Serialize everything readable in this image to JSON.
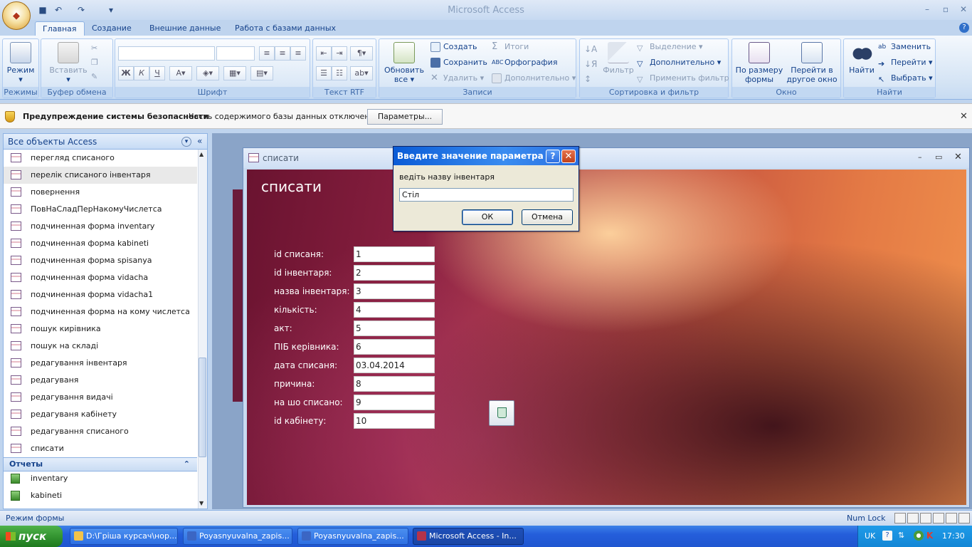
{
  "app": {
    "title": "Microsoft Access"
  },
  "quick_access": {
    "save": "save-icon",
    "undo": "undo-icon",
    "redo": "redo-icon"
  },
  "tabs": [
    {
      "label": "Главная",
      "active": true
    },
    {
      "label": "Создание"
    },
    {
      "label": "Внешние данные"
    },
    {
      "label": "Работа с базами данных"
    }
  ],
  "ribbon": {
    "views": {
      "mode": "Режим",
      "group": "Режимы"
    },
    "clipboard": {
      "paste": "Вставить",
      "group": "Буфер обмена"
    },
    "font": {
      "group": "Шрифт"
    },
    "rtf": {
      "group": "Текст RTF"
    },
    "records": {
      "refresh": "Обновить",
      "refresh2": "все",
      "create": "Создать",
      "save": "Сохранить",
      "delete": "Удалить",
      "totals": "Итоги",
      "spelling": "Орфография",
      "more": "Дополнительно",
      "group": "Записи"
    },
    "sort": {
      "filter": "Фильтр",
      "selection": "Выделение",
      "advanced": "Дополнительно",
      "toggle": "Применить фильтр",
      "group": "Сортировка и фильтр"
    },
    "window": {
      "fit1": "По размеру",
      "fit2": "формы",
      "switch1": "Перейти в",
      "switch2": "другое окно",
      "group": "Окно"
    },
    "find": {
      "find": "Найти",
      "replace": "Заменить",
      "goto": "Перейти",
      "select": "Выбрать",
      "group": "Найти"
    }
  },
  "security": {
    "title": "Предупреждение системы безопасности",
    "message": "Часть содержимого базы данных отключено",
    "button": "Параметры..."
  },
  "nav": {
    "header": "Все объекты Access",
    "forms": [
      "перегляд списаного",
      "перелік списаного інвентаря",
      "повернення",
      "ПовНаСладПерНакомуЧислетса",
      "подчиненная форма inventary",
      "подчиненная форма kabineti",
      "подчиненная форма spisanya",
      "подчиненная форма vidacha",
      "подчиненная форма vidacha1",
      "подчиненная форма на кому числетса",
      "пошук кирівника",
      "пошук на складі",
      "редагування інвентаря",
      "редагуваня",
      "редагування видачі",
      "редагуваня кабінету",
      "редагування списаного",
      "списати"
    ],
    "selected_index": 1,
    "reports_header": "Отчеты",
    "reports": [
      "inventary",
      "kabineti"
    ]
  },
  "form": {
    "window_title": "списати",
    "title": "списати",
    "fields": [
      {
        "label": "id списаня:",
        "value": "1"
      },
      {
        "label": "id інвентаря:",
        "value": "2"
      },
      {
        "label": "назва інвентаря:",
        "value": "3"
      },
      {
        "label": "кількість:",
        "value": "4"
      },
      {
        "label": "акт:",
        "value": "5"
      },
      {
        "label": "ПІБ керівника:",
        "value": "6"
      },
      {
        "label": "дата списаня:",
        "value": "03.04.2014"
      },
      {
        "label": "причина:",
        "value": "8"
      },
      {
        "label": "на шо списано:",
        "value": "9"
      },
      {
        "label": "id кабінету:",
        "value": "10"
      }
    ],
    "delete_icon": "recycle-bin-icon"
  },
  "dialog": {
    "title": "Введите значение параметра",
    "prompt": "ведіть назву інвентаря",
    "input": "Стіл",
    "ok": "ОК",
    "cancel": "Отмена"
  },
  "status": {
    "left": "Режим формы",
    "numlock": "Num Lock"
  },
  "taskbar": {
    "start": "пуск",
    "tasks": [
      {
        "label": "D:\\Гріша курсач\\нор...",
        "active": false
      },
      {
        "label": "Poyasnyuvalna_zapis...",
        "active": false
      },
      {
        "label": "Poyasnyuvalna_zapis...",
        "active": false
      },
      {
        "label": "Microsoft Access - In...",
        "active": true
      }
    ],
    "lang": "UK",
    "clock": "17:30"
  }
}
